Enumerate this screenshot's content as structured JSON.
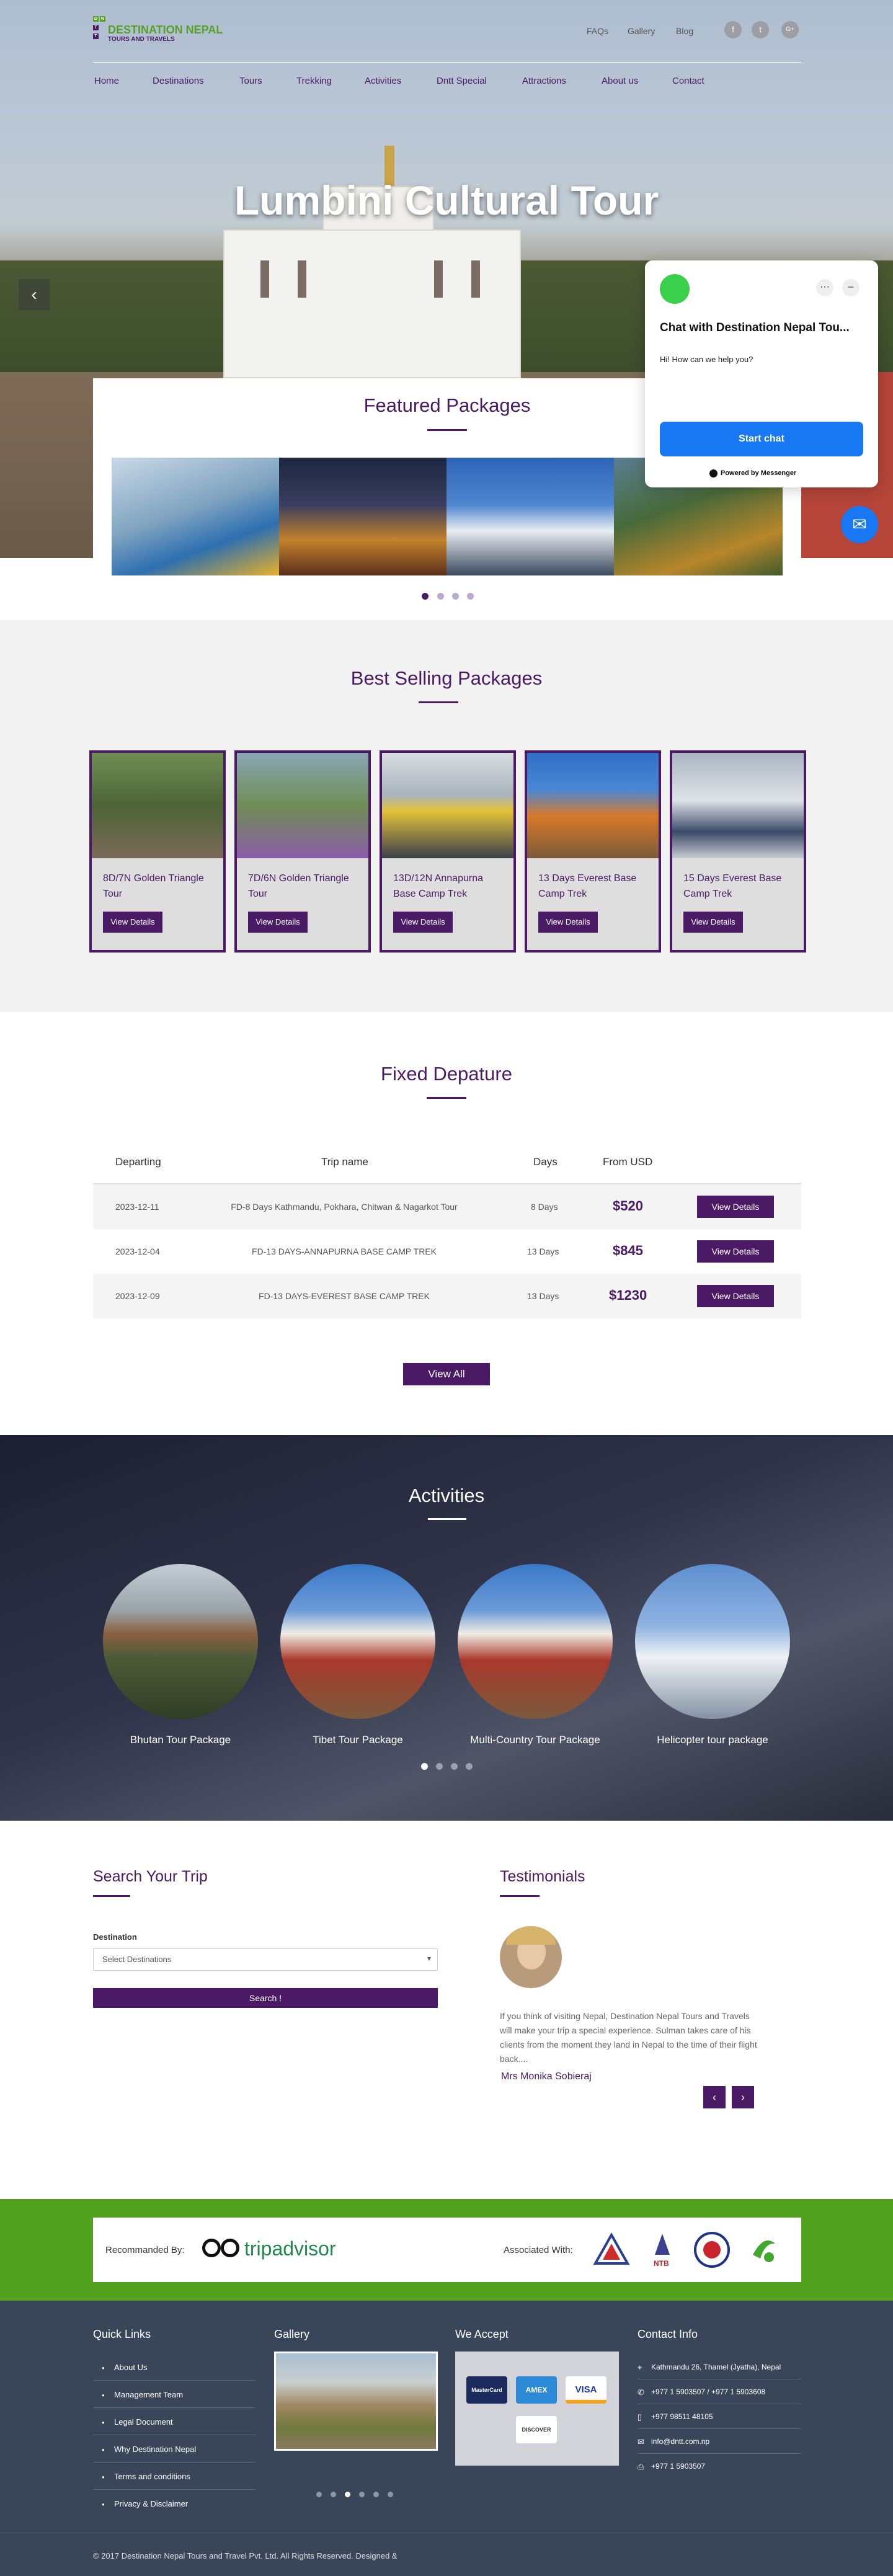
{
  "brand": {
    "logo_letters": [
      "D",
      "N",
      "T",
      "T"
    ],
    "name": "DESTINATION NEPAL",
    "tagline": "TOURS AND TRAVELS",
    "colors": {
      "primary": "#4a1a64",
      "green": "#52a21f",
      "footer": "#394559"
    }
  },
  "top_links": [
    "FAQs",
    "Gallery",
    "Blog"
  ],
  "social_icons": [
    {
      "icon": "facebook-icon",
      "glyph": "f"
    },
    {
      "icon": "twitter-icon",
      "glyph": "t"
    },
    {
      "icon": "google-plus-icon",
      "glyph": "G+"
    }
  ],
  "main_nav": [
    "Home",
    "Destinations",
    "Tours",
    "Trekking",
    "Activities",
    "Dntt Special",
    "Attractions",
    "About us",
    "Contact"
  ],
  "hero": {
    "title": "Lumbini Cultural Tour",
    "prev_glyph": "‹"
  },
  "featured": {
    "title": "Featured Packages",
    "slides": [
      "rafting",
      "temple-night",
      "mountain",
      "forest"
    ],
    "dots": 4,
    "active_dot": 0
  },
  "messenger": {
    "title": "Chat with Destination Nepal Tou...",
    "greeting": "Hi! How can we help you?",
    "start_label": "Start chat",
    "powered": "Powered by Messenger",
    "controls": [
      "···",
      "–"
    ]
  },
  "best_selling": {
    "title": "Best Selling Packages",
    "button_label": "View Details",
    "cards": [
      {
        "title": "8D/7N Golden Triangle Tour"
      },
      {
        "title": "7D/6N Golden Triangle Tour"
      },
      {
        "title": "13D/12N Annapurna Base Camp Trek"
      },
      {
        "title": "13 Days Everest Base Camp Trek"
      },
      {
        "title": "15 Days Everest Base Camp Trek"
      }
    ]
  },
  "fixed_departure": {
    "title": "Fixed Depature",
    "headers": [
      "Departing",
      "Trip name",
      "Days",
      "From USD"
    ],
    "rows": [
      {
        "date": "2023-12-11",
        "trip": "FD-8 Days Kathmandu, Pokhara, Chitwan & Nagarkot Tour",
        "days": "8 Days",
        "price": "$520",
        "button": "View Details"
      },
      {
        "date": "2023-12-04",
        "trip": "FD-13 DAYS-ANNAPURNA BASE CAMP TREK",
        "days": "13 Days",
        "price": "$845",
        "button": "View Details"
      },
      {
        "date": "2023-12-09",
        "trip": "FD-13 DAYS-EVEREST BASE CAMP TREK",
        "days": "13 Days",
        "price": "$1230",
        "button": "View Details"
      }
    ],
    "view_all": "View All"
  },
  "activities": {
    "title": "Activities",
    "items": [
      "Bhutan Tour Package",
      "Tibet Tour Package",
      "Multi-Country Tour Package",
      "Helicopter tour package"
    ],
    "dots": 4,
    "active_dot": 0
  },
  "search": {
    "title": "Search Your Trip",
    "label": "Destination",
    "select_value": "Select Destinations",
    "button": "Search !"
  },
  "testimonials": {
    "title": "Testimonials",
    "text": "If you think of visiting Nepal, Destination Nepal Tours and Travels will make your trip a special experience. Sulman takes care of his clients from the moment they land in Nepal to the time of their flight back....",
    "author": "Mrs Monika Sobieraj",
    "prev": "‹",
    "next": "›"
  },
  "partners": {
    "recommended_label": "Recommanded By:",
    "tripadvisor": "tripadvisor",
    "associated_label": "Associated With:",
    "logos": [
      "NMA",
      "NTB",
      "Nepal Govt",
      "TAAN"
    ]
  },
  "footer": {
    "quick_links_title": "Quick Links",
    "quick_links": [
      "About Us",
      "Management Team",
      "Legal Document",
      "Why Destination Nepal",
      "Terms and conditions",
      "Privacy & Disclaimer"
    ],
    "gallery_title": "Gallery",
    "gallery_dots": 6,
    "gallery_active": 2,
    "accept_title": "We Accept",
    "cards": [
      "MasterCard",
      "AMEX",
      "VISA",
      "DISCOVER"
    ],
    "contact_title": "Contact Info",
    "contacts": [
      {
        "icon": "location-icon",
        "glyph": "⌖",
        "text": "Kathmandu 26, Thamel (Jyatha), Nepal"
      },
      {
        "icon": "phone-icon",
        "glyph": "✆",
        "text": "+977 1 5903507 / +977 1 5903608"
      },
      {
        "icon": "mobile-icon",
        "glyph": "▯",
        "text": "+977 98511 48105"
      },
      {
        "icon": "email-icon",
        "glyph": "✉",
        "text": "info@dntt.com.np"
      },
      {
        "icon": "fax-icon",
        "glyph": "⎙",
        "text": "+977 1 5903507"
      }
    ],
    "copyright": "© 2017 Destination Nepal Tours and Travel Pvt. Ltd. All Rights Reserved. Designed &"
  }
}
